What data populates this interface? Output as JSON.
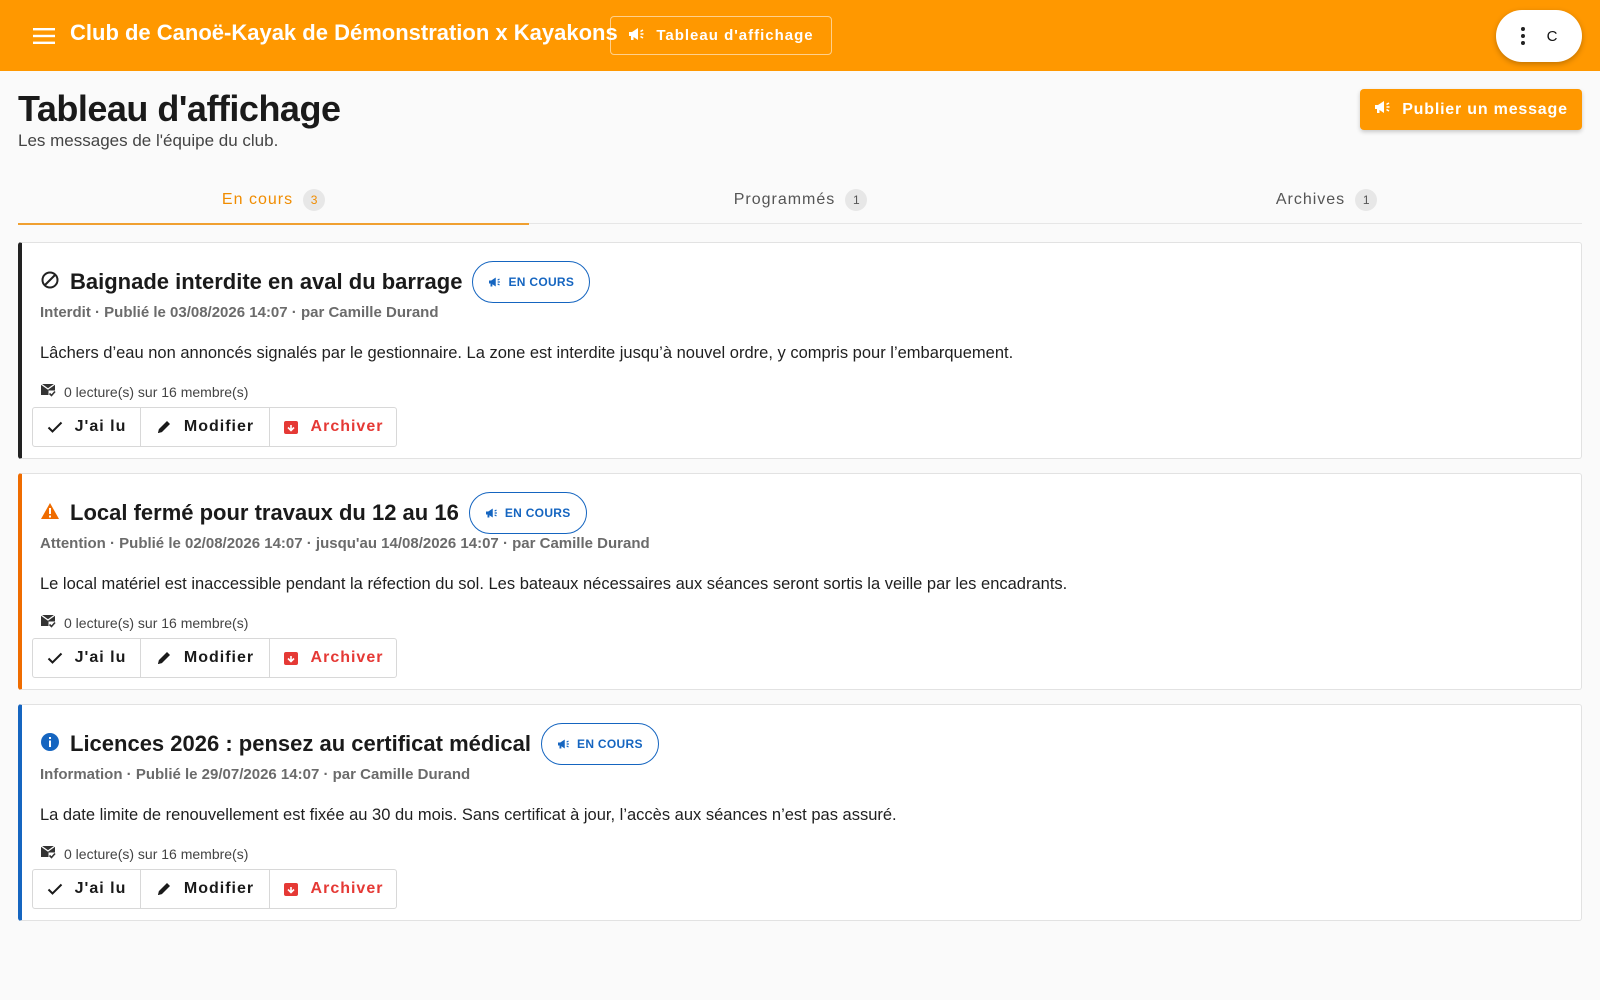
{
  "topbar": {
    "app_title": "Club de Canoë-Kayak de Démonstration x Kayakons",
    "nav_label": "Tableau d'affichage",
    "account_initial": "C",
    "color": "#ff9800"
  },
  "header": {
    "title": "Tableau d'affichage",
    "subtitle": "Les messages de l'équipe du club.",
    "publish_label": "Publier un message"
  },
  "tabs": [
    {
      "label": "En cours",
      "count": "3",
      "active": true
    },
    {
      "label": "Programmés",
      "count": "1",
      "active": false
    },
    {
      "label": "Archives",
      "count": "1",
      "active": false
    }
  ],
  "messages": [
    {
      "icon": "forbidden-icon",
      "accent": "#222222",
      "title": "Baignade interdite en aval du barrage",
      "badge": "EN COURS",
      "meta": "Interdit · Publié le 03/08/2026 14:07 · par Camille Durand",
      "body": "Lâchers d’eau non annoncés signalés par le gestionnaire. La zone est interdite jusqu’à nouvel ordre, y compris pour l’embarquement.",
      "reads": "0 lecture(s) sur 16 membre(s)"
    },
    {
      "icon": "warning-icon",
      "accent": "#ef6c00",
      "title": "Local fermé pour travaux du 12 au 16",
      "badge": "EN COURS",
      "meta": "Attention · Publié le 02/08/2026 14:07 · jusqu'au 14/08/2026 14:07 · par Camille Durand",
      "body": "Le local matériel est inaccessible pendant la réfection du sol. Les bateaux nécessaires aux séances seront sortis la veille par les encadrants.",
      "reads": "0 lecture(s) sur 16 membre(s)"
    },
    {
      "icon": "info-icon",
      "accent": "#1565c0",
      "title": "Licences 2026 : pensez au certificat médical",
      "badge": "EN COURS",
      "meta": "Information · Publié le 29/07/2026 14:07 · par Camille Durand",
      "body": "La date limite de renouvellement est fixée au 30 du mois. Sans certificat à jour, l’accès aux séances n’est pas assuré.",
      "reads": "0 lecture(s) sur 16 membre(s)"
    }
  ],
  "actions": {
    "read_label": "J'ai lu",
    "edit_label": "Modifier",
    "archive_label": "Archiver"
  }
}
